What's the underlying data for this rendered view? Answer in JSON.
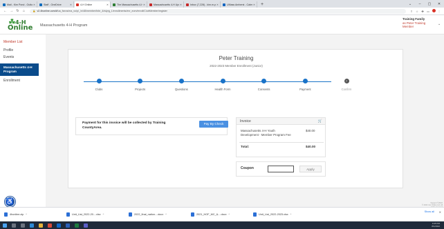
{
  "browser": {
    "tabs": [
      {
        "label": "Mail - Kim Pond - Outlook",
        "color": "#0f6cbd",
        "active": false
      },
      {
        "label": "Staff - OneDrive",
        "color": "#0f6cbd",
        "active": false
      },
      {
        "label": "4-H Online",
        "color": "#d93025",
        "active": true
      },
      {
        "label": "The Massachusetts 4-H Founda",
        "color": "#2e7d32",
        "active": false
      },
      {
        "label": "Massachusetts 4-H Upcoming",
        "color": "#c62828",
        "active": false
      },
      {
        "label": "Inbox (7,228) - kim.m.pond@g",
        "color": "#c62828",
        "active": false
      },
      {
        "label": "UMass Amherst - Calendar - M",
        "color": "#1565c0",
        "active": false
      }
    ],
    "url_prefix": "v2.4honline.com/#/",
    "url_rest": "ua_fseos/ma_vo/p/_/n/48/member/tnbr_4/wlyrg_1/enrollments/enr_eom/enroll/ClubMember/register",
    "icons": [
      "share-icon",
      "star-icon",
      "extension-icon",
      "sidebar-icon",
      "profile-icon",
      "menu-icon"
    ]
  },
  "header": {
    "logo_top": "4-H",
    "logo_bottom": "Online",
    "program_title": "Massachusetts 4-H Program",
    "family_label": "Training Family",
    "family_member_line1": "as Peter Training",
    "family_member_line2": "Member"
  },
  "sidebar": {
    "member_list": "Member List",
    "profile": "Profile",
    "events": "Events",
    "active_line1": "Massachusetts 4-H",
    "active_line2": "Program",
    "enrollment": "Enrollment"
  },
  "enrollment": {
    "member_name": "Peter Training",
    "subtitle": "2022-2023 Member Enrollment (Junior)",
    "steps": [
      {
        "label": "Clubs",
        "state": "done"
      },
      {
        "label": "Projects",
        "state": "done"
      },
      {
        "label": "Questions",
        "state": "done"
      },
      {
        "label": "Health Form",
        "state": "done"
      },
      {
        "label": "Consents",
        "state": "done"
      },
      {
        "label": "Payment",
        "state": "done"
      },
      {
        "label": "Confirm",
        "state": "current"
      }
    ],
    "current_step_number": "7"
  },
  "payment": {
    "message_line1": "Payment for this invoice will be collected by Training",
    "message_line2": "CountyArea.",
    "pay_button": "Pay By Check"
  },
  "invoice": {
    "title": "Invoice",
    "item_desc_line1": "Massachusetts 4-H Youth",
    "item_desc_line2": "Development - Member Program Fee",
    "item_amount": "$40.00",
    "total_label": "Total:",
    "total_amount": "$40.00"
  },
  "coupon": {
    "label": "Coupon",
    "input_value": "",
    "apply_button": "Apply"
  },
  "footnote": {
    "line1": "Support ©2022",
    "line2": "© 2022 4-H Online Ltd. All rights reserved"
  },
  "downloads": {
    "items": [
      "4honline.zip",
      "Unit_List_2022-20....xlsx",
      "2022_final_nation....docx",
      "2021_HOF_MC_&....docx",
      "Unit_List_2022-2023.xlsx"
    ],
    "show_all": "Show all"
  },
  "taskbar": {
    "time": "9:45 PM",
    "date": "8/1/2022"
  },
  "colors": {
    "accent_blue": "#1a73c8",
    "sidebar_active": "#0a4b8b",
    "brand_green": "#2f7d2f",
    "red_text": "#c0392b"
  }
}
